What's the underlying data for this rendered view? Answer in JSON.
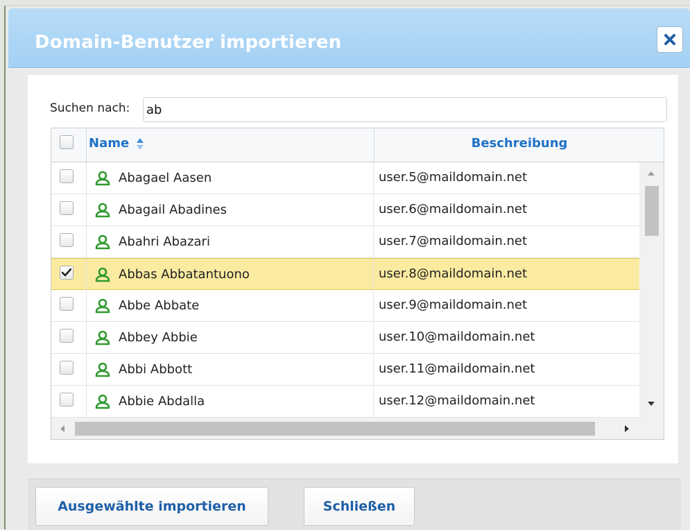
{
  "dialog": {
    "title": "Domain-Benutzer importieren",
    "close_icon": "close-icon"
  },
  "search": {
    "label": "Suchen nach:",
    "value": "ab"
  },
  "grid": {
    "columns": {
      "name": "Name",
      "description": "Beschreibung"
    },
    "sort": {
      "column": "Name",
      "direction": "ascending"
    },
    "rows": [
      {
        "name": "Abagael Aasen",
        "description": "user.5@maildomain.net",
        "checked": false
      },
      {
        "name": "Abagail Abadines",
        "description": "user.6@maildomain.net",
        "checked": false
      },
      {
        "name": "Abahri Abazari",
        "description": "user.7@maildomain.net",
        "checked": false
      },
      {
        "name": "Abbas Abbatantuono",
        "description": "user.8@maildomain.net",
        "checked": true
      },
      {
        "name": "Abbe Abbate",
        "description": "user.9@maildomain.net",
        "checked": false
      },
      {
        "name": "Abbey Abbie",
        "description": "user.10@maildomain.net",
        "checked": false
      },
      {
        "name": "Abbi Abbott",
        "description": "user.11@maildomain.net",
        "checked": false
      },
      {
        "name": "Abbie Abdalla",
        "description": "user.12@maildomain.net",
        "checked": false
      }
    ]
  },
  "buttons": {
    "import_selected": "Ausgewählte importieren",
    "close": "Schließen"
  },
  "colors": {
    "accent": "#1e72c6",
    "selected_row": "#fbeba0",
    "user_icon": "#2e9a2e",
    "titlebar": "#a8d4f5"
  }
}
